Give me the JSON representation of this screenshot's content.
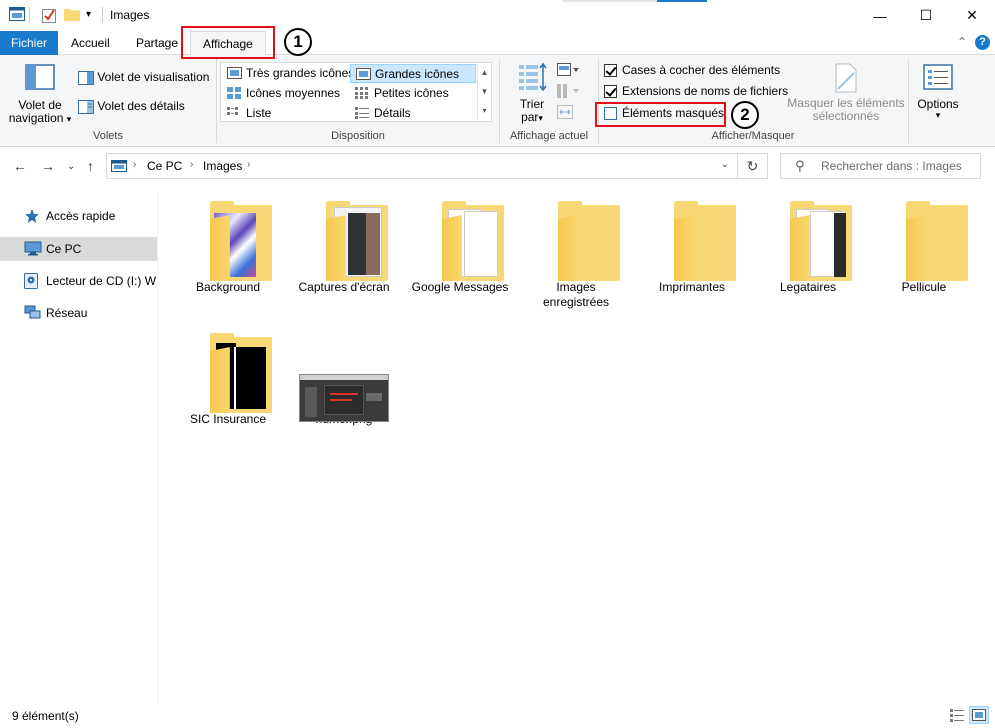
{
  "window": {
    "title": "Images",
    "minimize_glyph": "—",
    "maximize_glyph": "☐",
    "close_glyph": "✕"
  },
  "tabs": [
    {
      "label": "Fichier"
    },
    {
      "label": "Accueil"
    },
    {
      "label": "Partage"
    },
    {
      "label": "Affichage"
    }
  ],
  "ribbon": {
    "panes": {
      "navigation_label_1": "Volet de",
      "navigation_label_2": "navigation",
      "preview": "Volet de visualisation",
      "details": "Volet des détails",
      "group": "Volets"
    },
    "layout": {
      "items": [
        {
          "label": "Très grandes icônes"
        },
        {
          "label": "Grandes icônes"
        },
        {
          "label": "Icônes moyennes"
        },
        {
          "label": "Petites icônes"
        },
        {
          "label": "Liste"
        },
        {
          "label": "Détails"
        }
      ],
      "selected": "Grandes icônes",
      "group": "Disposition"
    },
    "current_view": {
      "sort_1": "Trier",
      "sort_2": "par",
      "group": "Affichage actuel"
    },
    "show_hide": {
      "item_checkboxes": {
        "label": "Cases à cocher des éléments",
        "checked": true
      },
      "file_extensions": {
        "label": "Extensions de noms de fichiers",
        "checked": true
      },
      "hidden_items": {
        "label": "Éléments masqués",
        "checked": false
      },
      "hide_selected_1": "Masquer les éléments",
      "hide_selected_2": "sélectionnés",
      "group": "Afficher/Masquer"
    },
    "options": "Options"
  },
  "address": {
    "crumbs": [
      "Ce PC",
      "Images"
    ],
    "search_placeholder": "Rechercher dans : Images"
  },
  "nav_pane": [
    {
      "label": "Accès rapide",
      "icon": "star-icon"
    },
    {
      "label": "Ce PC",
      "icon": "computer-icon",
      "selected": true
    },
    {
      "label": "Lecteur de CD (I:) WD",
      "icon": "cd-drive-icon"
    },
    {
      "label": "Réseau",
      "icon": "network-icon"
    }
  ],
  "items": [
    {
      "label": "Background",
      "type": "folder-photo"
    },
    {
      "label": "Captures d'écran",
      "type": "folder-docs"
    },
    {
      "label": "Google Messages",
      "type": "folder-docs"
    },
    {
      "label": "Images",
      "label2": "enregistrées",
      "type": "folder"
    },
    {
      "label": "Imprimantes",
      "type": "folder"
    },
    {
      "label": "Legataires",
      "type": "folder-docs"
    },
    {
      "label": "Pellicule",
      "type": "folder"
    },
    {
      "label": "SIC Insurance",
      "type": "folder-dark"
    },
    {
      "label": "numér.png",
      "type": "image"
    }
  ],
  "status": {
    "count": "9 élément(s)"
  },
  "annotations": {
    "badge_1": "1",
    "badge_2": "2"
  },
  "colors": {
    "file_tab": "#1979ca",
    "selection": "#cce8ff",
    "annotation_red": "#e3101b",
    "folder": "#f8d775"
  }
}
